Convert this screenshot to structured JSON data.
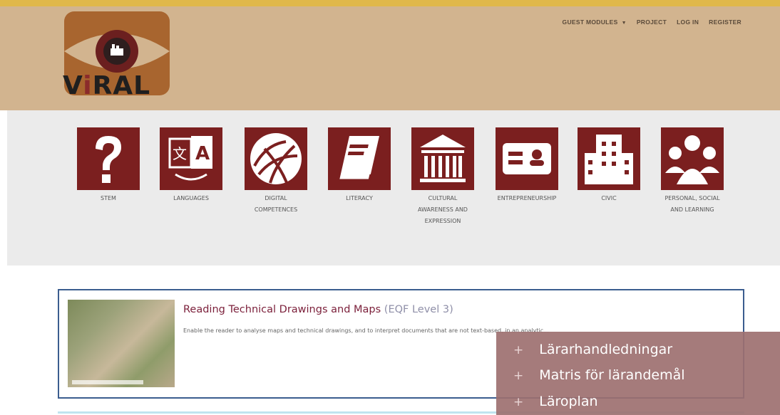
{
  "brand": {
    "name_pre": "V",
    "name_i": "i",
    "name_post": "RAL"
  },
  "nav": {
    "guest_modules": "GUEST MODULES",
    "guest_modules_caret": "▼",
    "project": "PROJECT",
    "login": "LOG IN",
    "register": "REGISTER"
  },
  "categories": [
    {
      "label": "STEM",
      "icon": "question-icon"
    },
    {
      "label": "LANGUAGES",
      "icon": "translate-icon"
    },
    {
      "label": "DIGITAL COMPETENCES",
      "icon": "network-globe-icon"
    },
    {
      "label": "LITERACY",
      "icon": "book-icon"
    },
    {
      "label": "CULTURAL AWARENESS AND EXPRESSION",
      "icon": "museum-icon"
    },
    {
      "label": "ENTREPRENEURSHIP",
      "icon": "id-card-icon"
    },
    {
      "label": "CIVIC",
      "icon": "building-icon"
    },
    {
      "label": "PERSONAL, SOCIAL AND LEARNING",
      "icon": "people-group-icon"
    }
  ],
  "module": {
    "title": "Reading Technical Drawings and Maps",
    "level": "(EQF Level 3)",
    "description": "Enable the reader to analyse maps and technical drawings, and to interpret documents that are not text-based, in an analytic..."
  },
  "overlay": {
    "items": [
      "Lärarhandledningar",
      "Matris för lärandemål",
      "Läroplan"
    ],
    "plus": "+"
  },
  "colors": {
    "accent": "#7b1f1f",
    "header_bg": "#d2b48f",
    "topbar": "#e0b84a",
    "overlay": "#9d7070"
  }
}
